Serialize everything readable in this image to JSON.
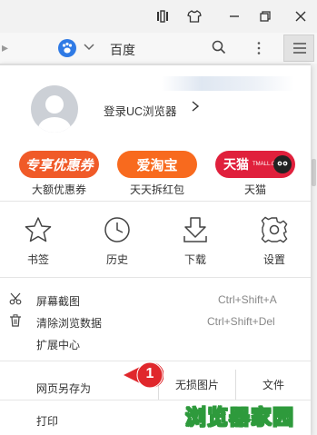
{
  "window": {
    "controls": [
      "split-icon",
      "shirt-icon",
      "minimize-icon",
      "restore-icon",
      "close-icon"
    ]
  },
  "addressbar": {
    "engine": "百度",
    "icons": [
      "baidu-paw-icon",
      "chevron-down-icon",
      "search-icon",
      "more-vertical-icon",
      "menu-icon"
    ]
  },
  "profile": {
    "login_label": "登录UC浏览器",
    "chevron": "›"
  },
  "promos": [
    {
      "badge": "专享优惠券",
      "caption": "大额优惠券",
      "color": "#f05a28"
    },
    {
      "badge": "爱淘宝",
      "caption": "天天拆红包",
      "color": "#f86a1e"
    },
    {
      "badge": "天猫",
      "sub": "TMALL.COM",
      "caption": "天猫",
      "color": "#e0203c"
    }
  ],
  "tools": [
    {
      "label": "书签",
      "icon": "star-icon"
    },
    {
      "label": "历史",
      "icon": "clock-icon"
    },
    {
      "label": "下载",
      "icon": "download-icon"
    },
    {
      "label": "设置",
      "icon": "gear-icon"
    }
  ],
  "rows": [
    {
      "label": "屏幕截图",
      "shortcut": "Ctrl+Shift+A",
      "icon": "scissors-icon"
    },
    {
      "label": "清除浏览数据",
      "shortcut": "Ctrl+Shift+Del",
      "icon": "trash-icon"
    },
    {
      "label": "扩展中心",
      "shortcut": "",
      "icon": ""
    }
  ],
  "save_row": {
    "label": "网页另存为",
    "options": [
      "无损图片",
      "文件"
    ]
  },
  "print_label": "打印",
  "callout": "1",
  "watermark": "浏览器家园"
}
